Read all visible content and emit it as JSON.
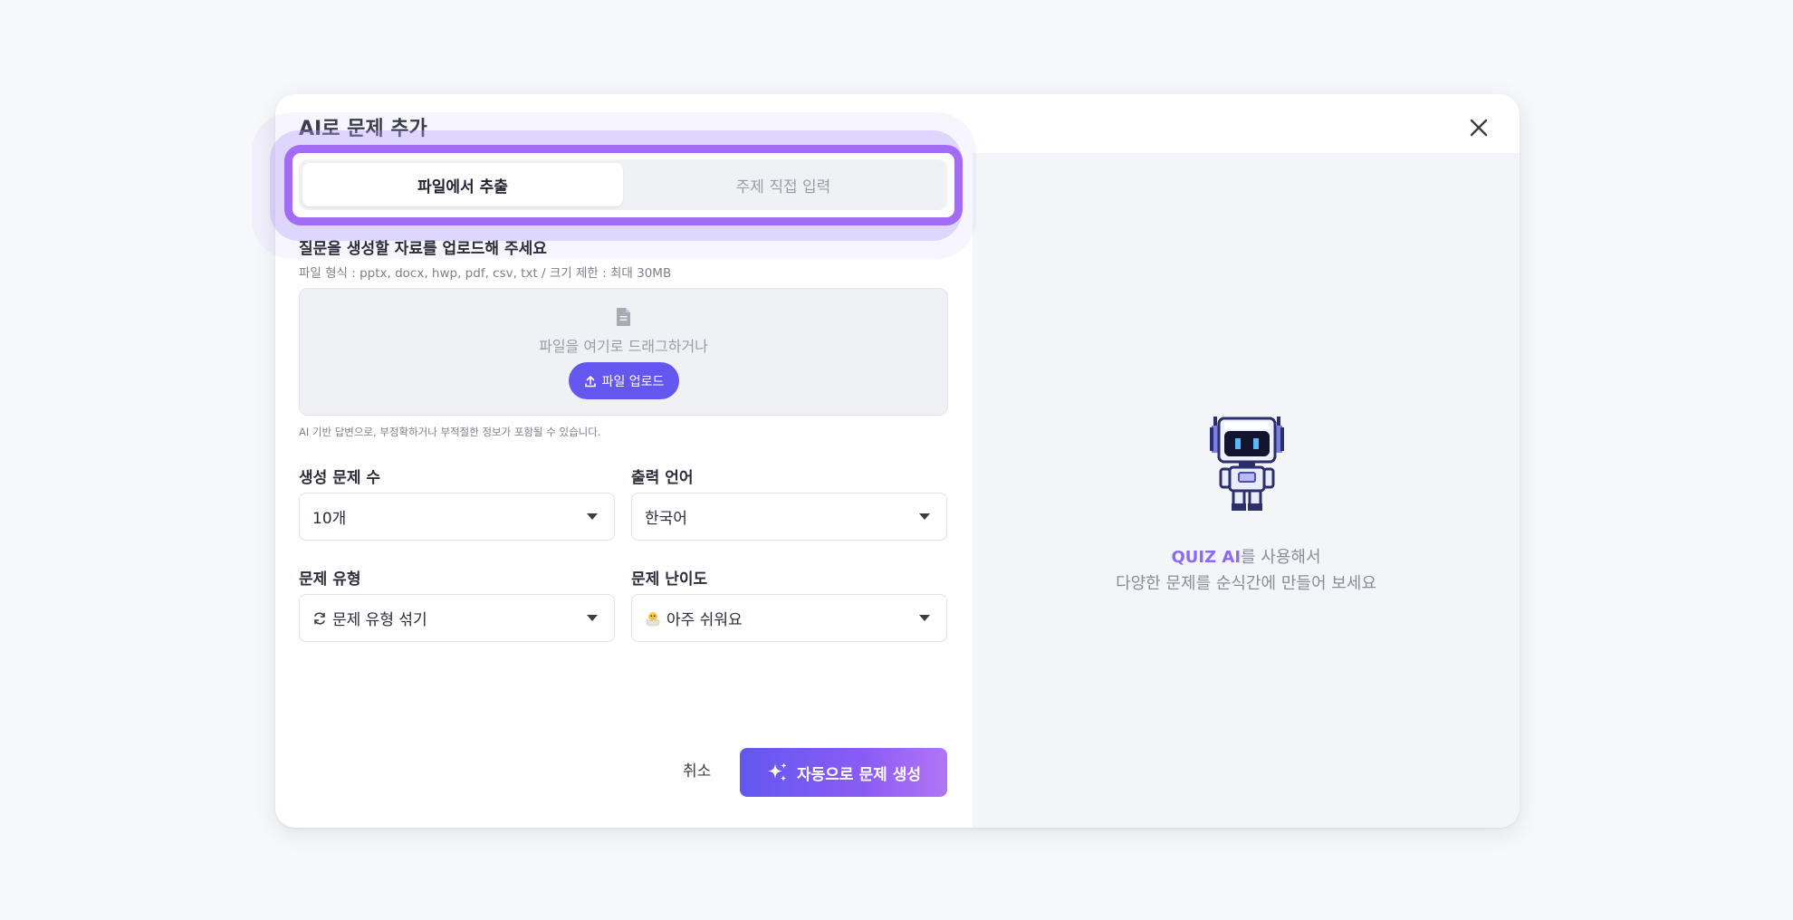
{
  "modal": {
    "title": "AI로 문제 추가"
  },
  "tabs": [
    {
      "label": "파일에서 추출",
      "active": true
    },
    {
      "label": "주제 직접 입력",
      "active": false
    }
  ],
  "upload": {
    "title": "질문을 생성할 자료를 업로드해 주세요",
    "subtitle": "파일 형식 : pptx, docx, hwp, pdf, csv, txt / 크기 제한 : 최대 30MB",
    "drop_text": "파일을 여기로 드래그하거나",
    "button_label": "파일 업로드",
    "disclaimer": "AI 기반 답변으로, 부정확하거나 부적절한 정보가 포함될 수 있습니다."
  },
  "fields": {
    "count": {
      "label": "생성 문제 수",
      "value": "10개"
    },
    "language": {
      "label": "출력 언어",
      "value": "한국어"
    },
    "type": {
      "label": "문제 유형",
      "value": "문제 유형 섞기",
      "icon": "refresh-icon"
    },
    "difficulty": {
      "label": "문제 난이도",
      "value": "아주 쉬워요",
      "icon": "hatching-chick-emoji"
    }
  },
  "actions": {
    "cancel_label": "취소",
    "generate_label": "자동으로 문제 생성"
  },
  "promo": {
    "accent": "QUIZ AI",
    "line1_rest": "를 사용해서",
    "line2": "다양한 문제를 순식간에 만들어 보세요"
  },
  "colors": {
    "accent": "#6357f0",
    "highlight_border": "#a36cf5",
    "promo_accent": "#8a6cf0"
  }
}
